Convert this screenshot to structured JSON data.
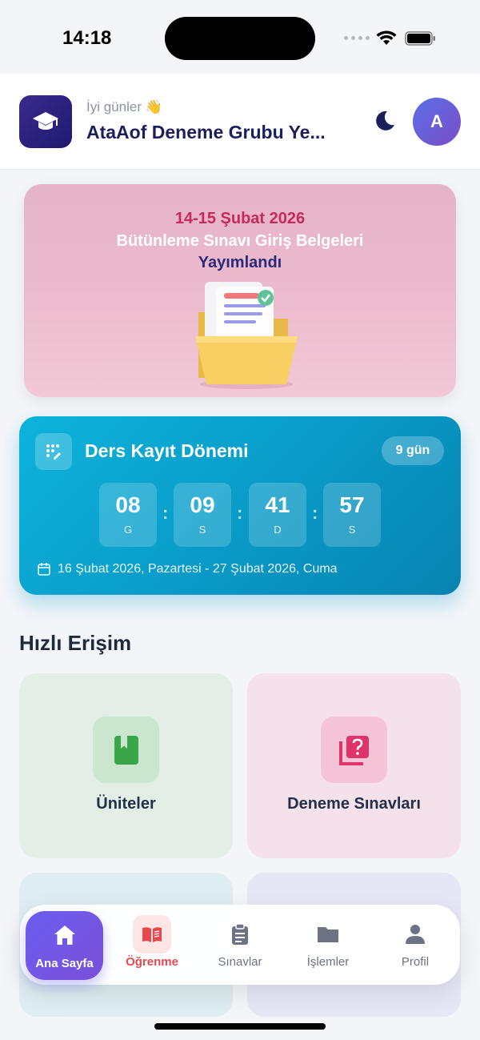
{
  "status_bar": {
    "time": "14:18"
  },
  "header": {
    "greeting": "İyi günler 👋",
    "group_name": "AtaAof Deneme Grubu Ye...",
    "avatar_letter": "A"
  },
  "banner": {
    "line1": "14-15 Şubat 2026",
    "line2": "Bütünleme Sınavı Giriş Belgeleri",
    "line3": "Yayımlandı"
  },
  "countdown": {
    "title": "Ders Kayıt Dönemi",
    "badge": "9 gün",
    "units": [
      {
        "value": "08",
        "label": "G"
      },
      {
        "value": "09",
        "label": "S"
      },
      {
        "value": "41",
        "label": "D"
      },
      {
        "value": "57",
        "label": "S"
      }
    ],
    "separator": ":",
    "date_range": "16 Şubat 2026, Pazartesi - 27 Şubat 2026, Cuma"
  },
  "quick_access": {
    "title": "Hızlı Erişim",
    "tiles": [
      {
        "label": "Üniteler",
        "icon": "book-icon",
        "bg": "#e3efe6",
        "icon_bg": "#cbe6cf",
        "icon_color": "#3aa64a"
      },
      {
        "label": "Deneme Sınavları",
        "icon": "quiz-icon",
        "bg": "#f5e1ea",
        "icon_bg": "#f5c4d6",
        "icon_color": "#e0336a"
      }
    ]
  },
  "bottom_nav": {
    "items": [
      {
        "label": "Ana Sayfa",
        "icon": "home-icon",
        "active": true
      },
      {
        "label": "Öğrenme",
        "icon": "open-book-icon",
        "highlight": true
      },
      {
        "label": "Sınavlar",
        "icon": "clipboard-icon"
      },
      {
        "label": "İşlemler",
        "icon": "folder-icon"
      },
      {
        "label": "Profil",
        "icon": "person-icon"
      }
    ]
  },
  "colors": {
    "accent": "#6a5ef0",
    "countdown_bg": "#0a9cc9",
    "brand_dark": "#1c1f5e",
    "learn_red": "#e5484d"
  }
}
